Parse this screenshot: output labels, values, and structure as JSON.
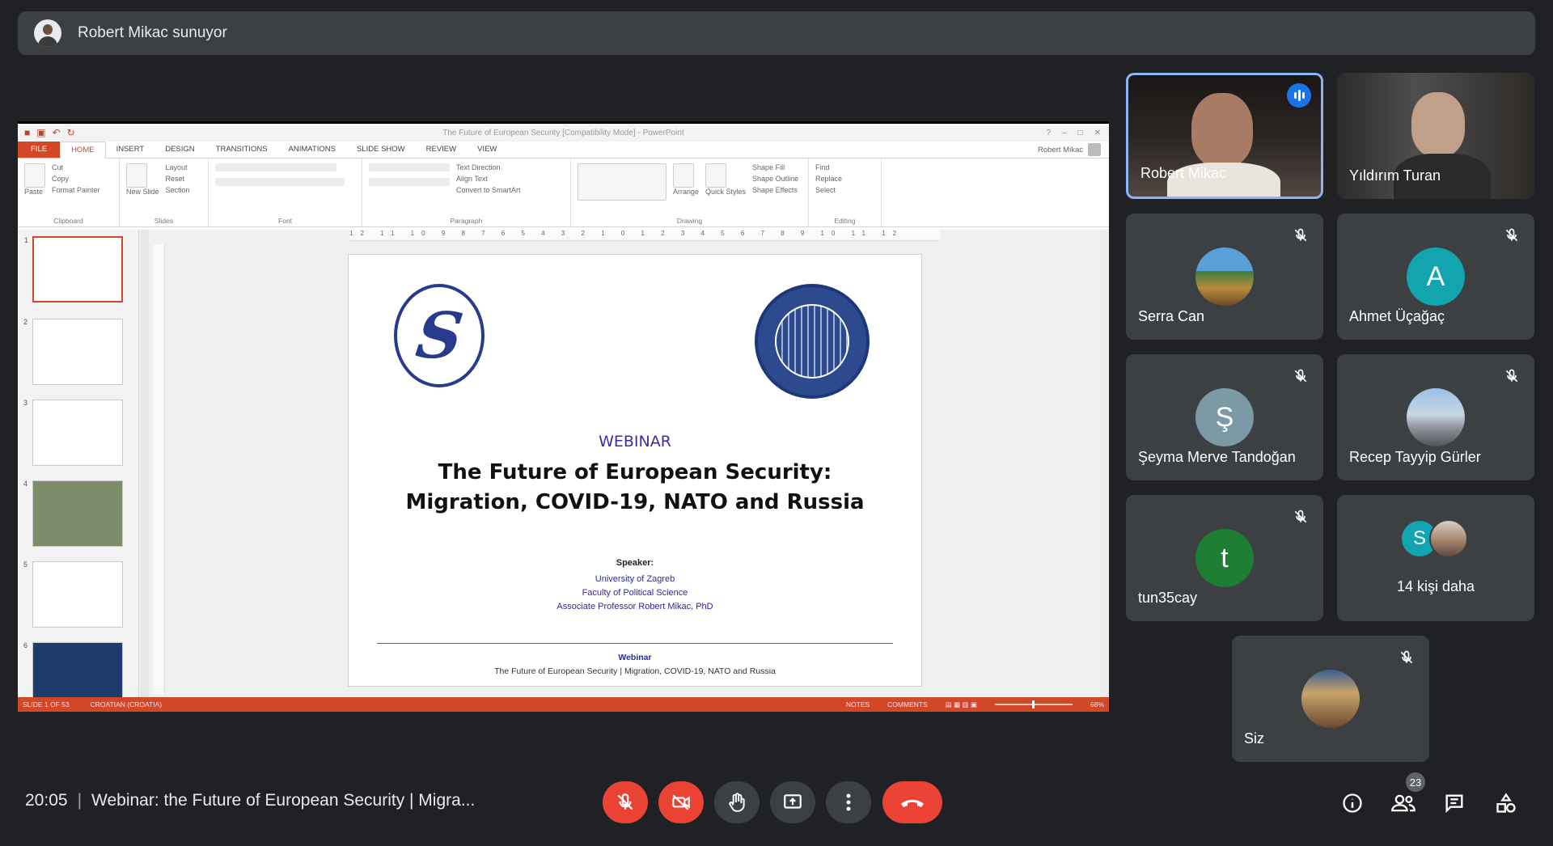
{
  "presenter_bar": {
    "text": "Robert Mikac sunuyor"
  },
  "powerpoint": {
    "doc_title": "The Future of European Security [Compatibility Mode] - PowerPoint",
    "user": "Robert Mikac",
    "tabs": [
      "FILE",
      "HOME",
      "INSERT",
      "DESIGN",
      "TRANSITIONS",
      "ANIMATIONS",
      "SLIDE SHOW",
      "REVIEW",
      "VIEW"
    ],
    "active_tab": "HOME",
    "ribbon_groups": [
      "Clipboard",
      "Slides",
      "Font",
      "Paragraph",
      "Drawing",
      "Editing"
    ],
    "ribbon_items": {
      "cut": "Cut",
      "copy": "Copy",
      "format_painter": "Format Painter",
      "paste": "Paste",
      "new_slide": "New Slide",
      "layout": "Layout",
      "reset": "Reset",
      "section": "Section",
      "text_direction": "Text Direction",
      "align_text": "Align Text",
      "convert_smartart": "Convert to SmartArt",
      "arrange": "Arrange",
      "quick_styles": "Quick Styles",
      "shape_fill": "Shape Fill",
      "shape_outline": "Shape Outline",
      "shape_effects": "Shape Effects",
      "find": "Find",
      "replace": "Replace",
      "select": "Select"
    },
    "ruler_text": "12 11 10 9 8 7 6 5 4 3 2 1 0 1 2 3 4 5 6 7 8 9 10 11 12",
    "slide_numbers": [
      "1",
      "2",
      "3",
      "4",
      "5",
      "6"
    ],
    "statusbar": {
      "slide": "SLIDE 1 OF 53",
      "language": "CROATIAN (CROATIA)",
      "notes": "NOTES",
      "comments": "COMMENTS",
      "zoom": "68%"
    },
    "slide": {
      "webinar": "WEBINAR",
      "title_line1": "The Future of European Security:",
      "title_line2": "Migration, COVID-19, NATO and Russia",
      "speaker_heading": "Speaker:",
      "speaker_line1": "University of Zagreb",
      "speaker_line2": "Faculty of Political Science",
      "speaker_line3": "Associate Professor Robert Mikac, PhD",
      "footer_heading": "Webinar",
      "footer_text": "The Future of European Security | Migration, COVID-19, NATO and Russia"
    }
  },
  "participants": [
    {
      "name": "Robert Mikac",
      "type": "video",
      "speaking": true
    },
    {
      "name": "Yıldırım Turan",
      "type": "video"
    },
    {
      "name": "Serra Can",
      "type": "photo",
      "muted": true
    },
    {
      "name": "Ahmet Üçağaç",
      "type": "letter",
      "letter": "A",
      "color": "#12a4af",
      "muted": true
    },
    {
      "name": "Şeyma Merve Tandoğan",
      "type": "letter",
      "letter": "Ş",
      "color": "#7b9aa5",
      "muted": true
    },
    {
      "name": "Recep Tayyip Gürler",
      "type": "photo",
      "muted": true
    },
    {
      "name": "tun35cay",
      "type": "letter",
      "letter": "t",
      "color": "#1e7e34",
      "muted": true
    },
    {
      "name": "14 kişi daha",
      "type": "more",
      "letter": "S",
      "color": "#12a4af"
    },
    {
      "name": "Siz",
      "type": "photo",
      "muted": true
    }
  ],
  "bottom_bar": {
    "time": "20:05",
    "separator": "|",
    "meeting_title": "Webinar: the Future of European Security | Migra...",
    "participant_count": "23"
  },
  "icons": [
    "mic-off-icon",
    "camera-off-icon",
    "raise-hand-icon",
    "present-icon",
    "more-options-icon",
    "end-call-icon",
    "info-icon",
    "people-icon",
    "chat-icon",
    "activities-icon"
  ],
  "colors": {
    "background": "#202124",
    "tile": "#3c4043",
    "danger": "#ea4335",
    "ppt_accent": "#d24726",
    "active_speaker": "#8ab4f8"
  }
}
